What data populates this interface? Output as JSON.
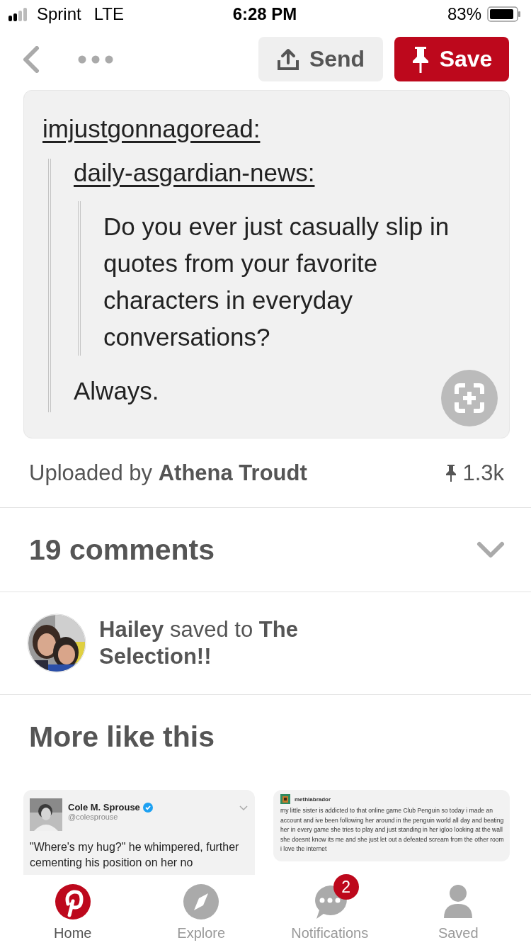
{
  "status_bar": {
    "carrier": "Sprint",
    "network": "LTE",
    "time": "6:28 PM",
    "battery": "83%"
  },
  "toolbar": {
    "send": "Send",
    "save": "Save"
  },
  "pin": {
    "username": "imjustgonnagoread:",
    "reblog_user": "daily-asgardian-news:",
    "quote": "Do you ever just casually slip in quotes from your favorite characters in everyday conversations?",
    "reply": "Always."
  },
  "upload": {
    "text": "Uploaded by **Athena Troudt**",
    "saves": "1.3k"
  },
  "comments": {
    "label": "19 comments",
    "expanded": false
  },
  "activity": {
    "text": "**Hailey** saved to **The Selection!!**"
  },
  "more": {
    "title": "More like this",
    "cards": [
      {
        "kind": "tweet",
        "name": "Cole M. Sprouse",
        "handle": "@colesprouse",
        "verified": true,
        "text": "\"Where's my hug?\" he whimpered, further cementing his position on her no"
      },
      {
        "kind": "post",
        "name": "methlabrador",
        "text": "my little sister is addicted to that online game Club Penguin so today i made an account and ive been following her around in the penguin world all day and beating her in every game she tries to play and just standing in her igloo looking at the wall she doesnt know its me and she just let out a defeated scream from the other room i love the internet"
      }
    ]
  },
  "tabs": [
    {
      "kind": "home",
      "label": "Home",
      "selected": true
    },
    {
      "kind": "explore",
      "label": "Explore",
      "selected": false
    },
    {
      "kind": "notifications",
      "label": "Notifications",
      "selected": false,
      "badge": "2"
    },
    {
      "kind": "saved",
      "label": "Saved",
      "selected": false
    }
  ]
}
